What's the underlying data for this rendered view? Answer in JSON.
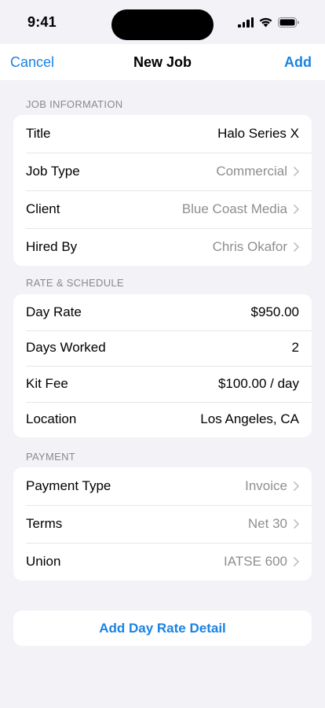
{
  "status_bar": {
    "time": "9:41"
  },
  "nav": {
    "cancel_label": "Cancel",
    "title": "New Job",
    "add_label": "Add"
  },
  "sections": [
    {
      "header": "JOB INFORMATION",
      "rows": [
        {
          "label": "Title",
          "value": "Halo Series X",
          "chevron": false
        },
        {
          "label": "Job Type",
          "value": "Commercial",
          "chevron": true
        },
        {
          "label": "Client",
          "value": "Blue Coast Media",
          "chevron": true
        },
        {
          "label": "Hired By",
          "value": "Chris Okafor",
          "chevron": true
        }
      ]
    },
    {
      "header": "RATE & SCHEDULE",
      "rows": [
        {
          "label": "Day Rate",
          "value": "$950.00",
          "chevron": false
        },
        {
          "label": "Days Worked",
          "value": "2",
          "chevron": false
        },
        {
          "label": "Kit Fee",
          "value": "$100.00 / day",
          "chevron": false
        },
        {
          "label": "Location",
          "value": "Los Angeles, CA",
          "chevron": false
        }
      ]
    },
    {
      "header": "PAYMENT",
      "rows": [
        {
          "label": "Payment Type",
          "value": "Invoice",
          "chevron": true
        },
        {
          "label": "Terms",
          "value": "Net 30",
          "chevron": true
        },
        {
          "label": "Union",
          "value": "IATSE 600",
          "chevron": true
        }
      ]
    }
  ],
  "action": {
    "label": "Add Day Rate Detail"
  },
  "colors": {
    "accent": "#1a82e2",
    "background": "#f2f2f7",
    "muted_text": "#8e8e93"
  }
}
